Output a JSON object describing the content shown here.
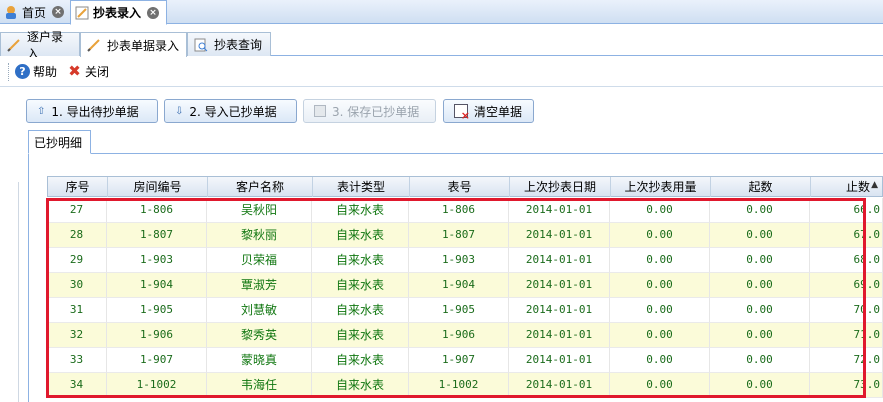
{
  "top_tabs": [
    {
      "label": "首页",
      "icon": "home-icon"
    },
    {
      "label": "抄表录入",
      "icon": "pencil-icon"
    }
  ],
  "sub_tabs": [
    {
      "label": "逐户录入",
      "icon": "pencil-icon"
    },
    {
      "label": "抄表单据录入",
      "icon": "pencil-icon"
    },
    {
      "label": "抄表查询",
      "icon": "search-doc-icon"
    }
  ],
  "toolbar": {
    "help_label": "帮助",
    "close_label": "关闭"
  },
  "actions": {
    "export_label": "1. 导出待抄单据",
    "import_label": "2. 导入已抄单据",
    "save_label": "3. 保存已抄单据",
    "clear_label": "清空单据"
  },
  "panel_tab": "已抄明细",
  "grid": {
    "columns": [
      "序号",
      "房间编号",
      "客户名称",
      "表计类型",
      "表号",
      "上次抄表日期",
      "上次抄表用量",
      "起数",
      "止数"
    ],
    "rows": [
      [
        "27",
        "1-806",
        "吴秋阳",
        "自来水表",
        "1-806",
        "2014-01-01",
        "0.00",
        "0.00",
        "66.0"
      ],
      [
        "28",
        "1-807",
        "黎秋丽",
        "自来水表",
        "1-807",
        "2014-01-01",
        "0.00",
        "0.00",
        "67.0"
      ],
      [
        "29",
        "1-903",
        "贝荣福",
        "自来水表",
        "1-903",
        "2014-01-01",
        "0.00",
        "0.00",
        "68.0"
      ],
      [
        "30",
        "1-904",
        "覃淑芳",
        "自来水表",
        "1-904",
        "2014-01-01",
        "0.00",
        "0.00",
        "69.0"
      ],
      [
        "31",
        "1-905",
        "刘慧敏",
        "自来水表",
        "1-905",
        "2014-01-01",
        "0.00",
        "0.00",
        "70.0"
      ],
      [
        "32",
        "1-906",
        "黎秀英",
        "自来水表",
        "1-906",
        "2014-01-01",
        "0.00",
        "0.00",
        "71.0"
      ],
      [
        "33",
        "1-907",
        "蒙晓真",
        "自来水表",
        "1-907",
        "2014-01-01",
        "0.00",
        "0.00",
        "72.0"
      ],
      [
        "34",
        "1-1002",
        "韦海任",
        "自来水表",
        "1-1002",
        "2014-01-01",
        "0.00",
        "0.00",
        "73.0"
      ]
    ]
  },
  "colors": {
    "highlight_border": "#e0182d",
    "row_alt": "#fbfbd9",
    "text_green": "#1a6b1a"
  }
}
